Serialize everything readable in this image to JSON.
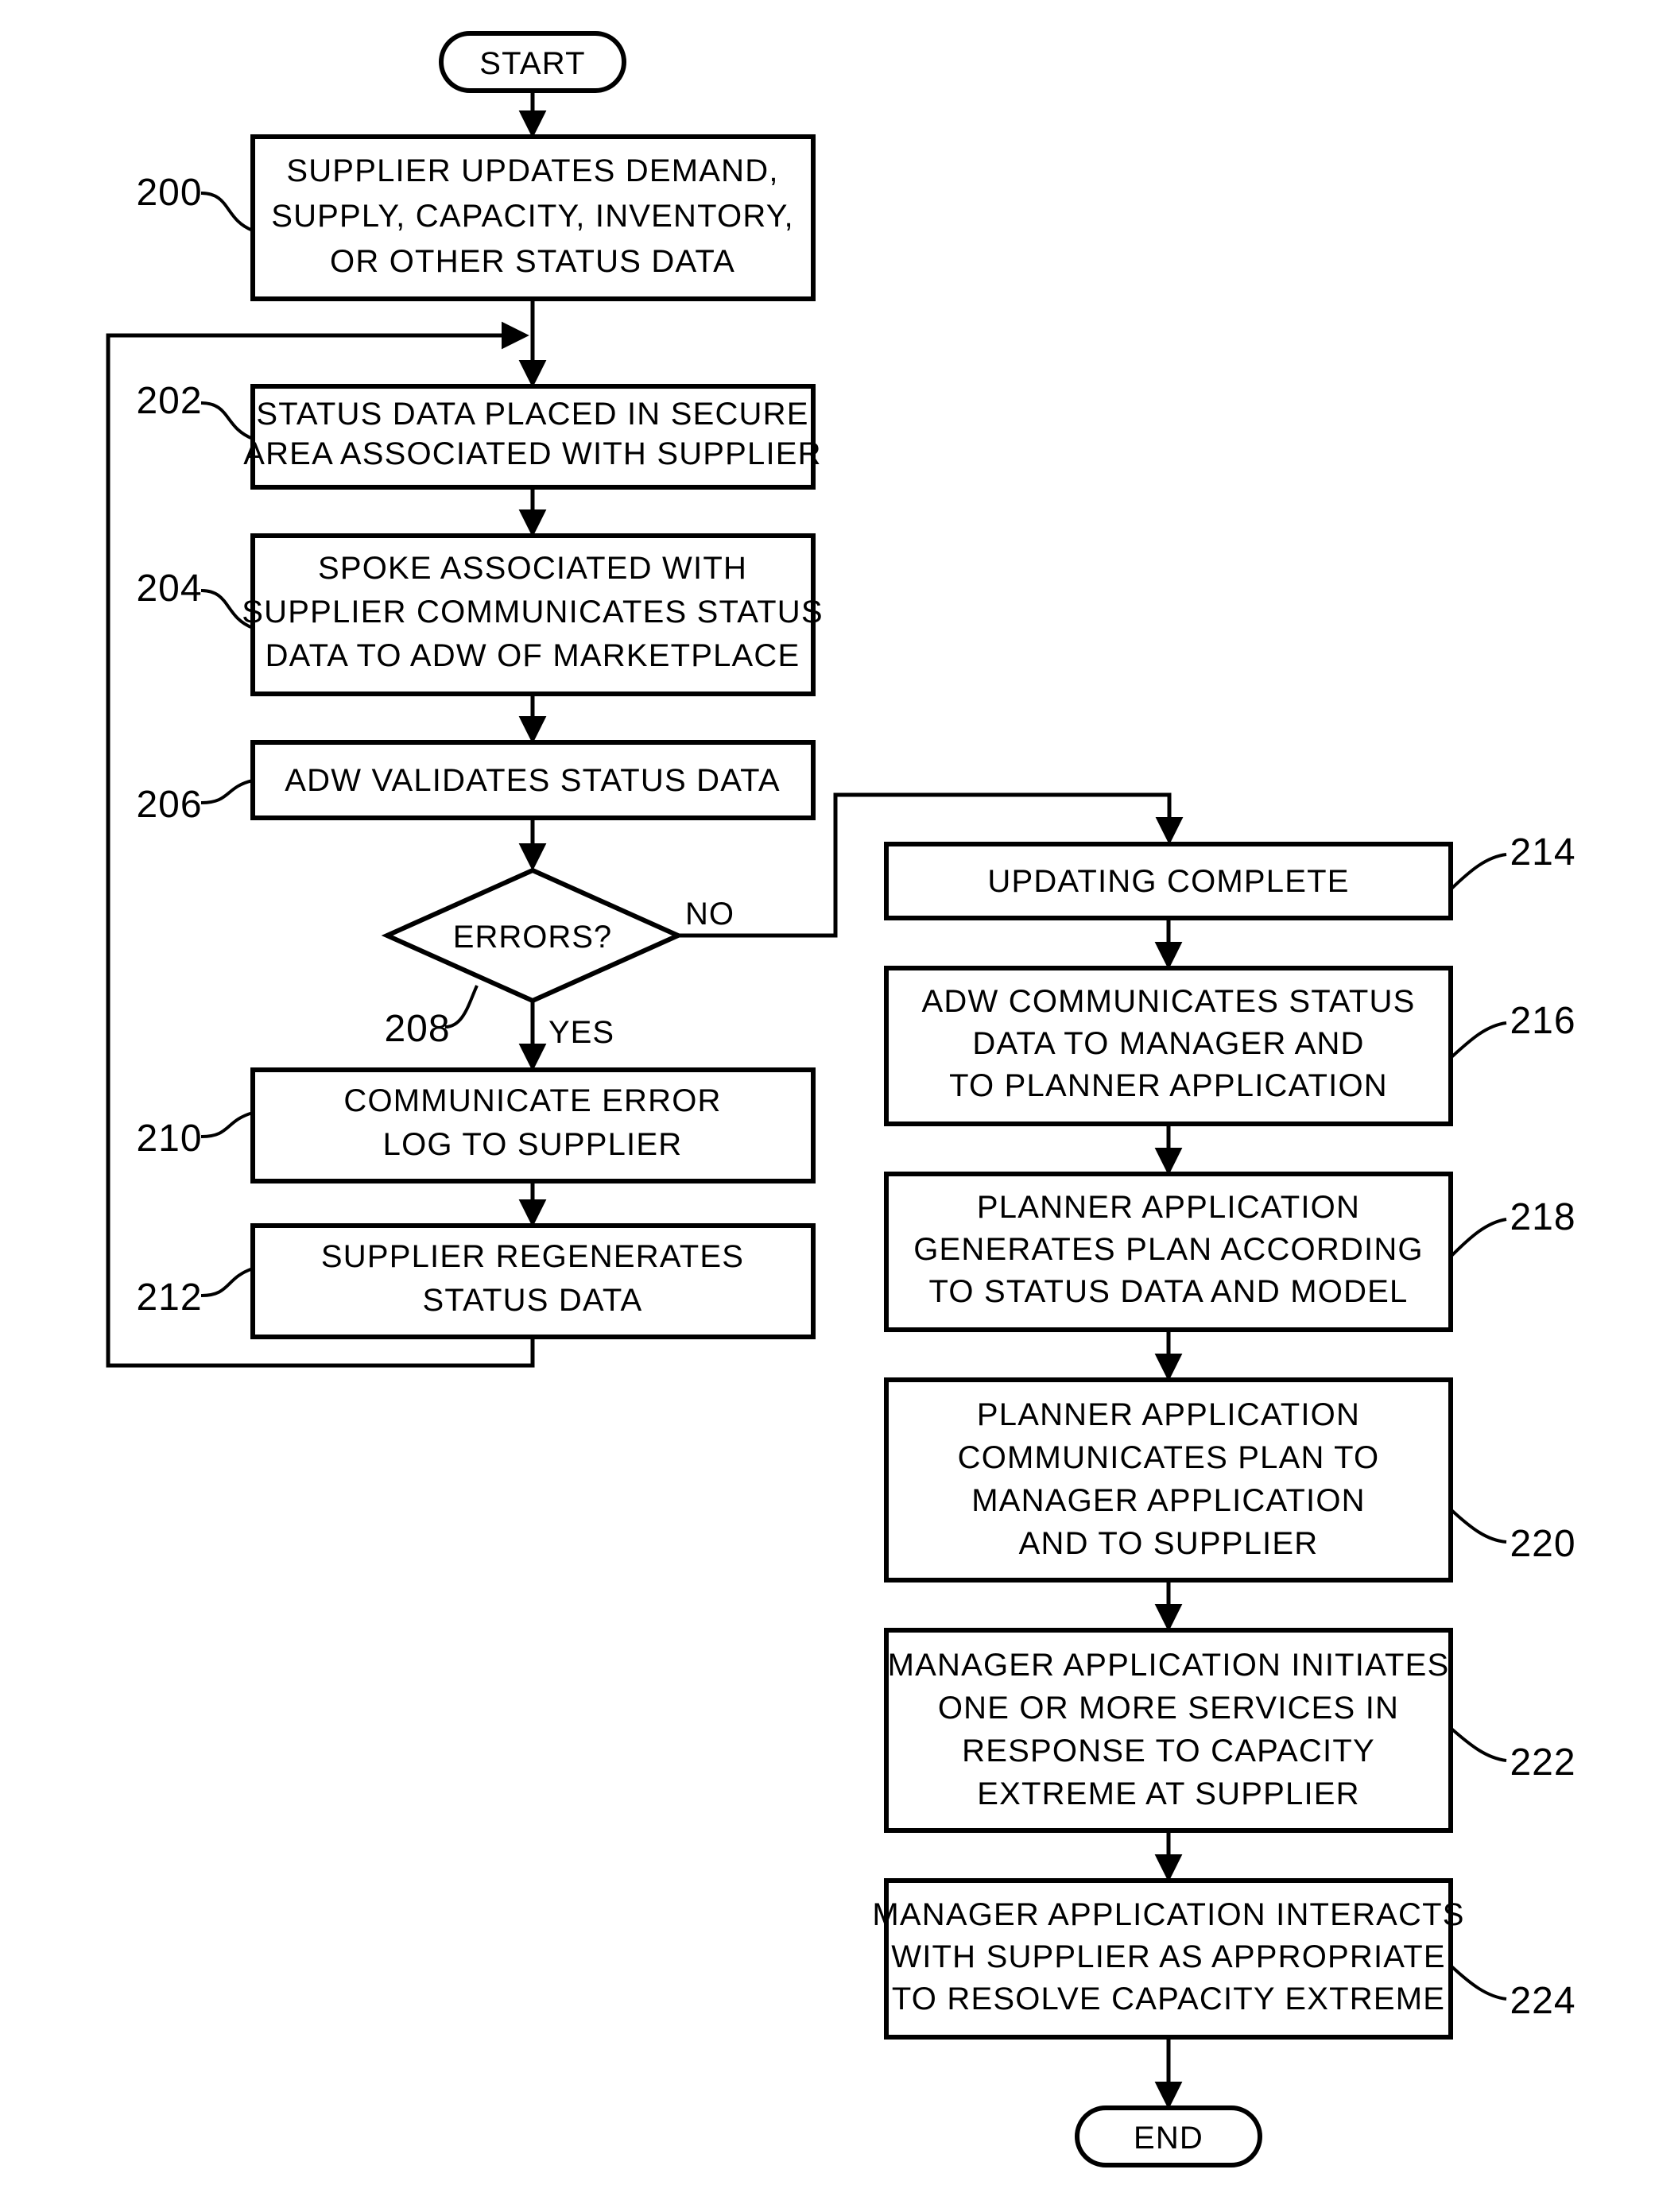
{
  "diagram": {
    "type": "flowchart",
    "title": "",
    "terminators": {
      "start": "START",
      "end": "END"
    },
    "decision": {
      "label": "ERRORS?",
      "ref": "208",
      "branch_yes": "YES",
      "branch_no": "NO"
    },
    "nodes": [
      {
        "ref": "200",
        "lines": [
          "SUPPLIER UPDATES DEMAND,",
          "SUPPLY, CAPACITY, INVENTORY,",
          "OR OTHER STATUS DATA"
        ]
      },
      {
        "ref": "202",
        "lines": [
          "STATUS DATA PLACED IN SECURE",
          "AREA ASSOCIATED WITH SUPPLIER"
        ]
      },
      {
        "ref": "204",
        "lines": [
          "SPOKE ASSOCIATED WITH",
          "SUPPLIER COMMUNICATES STATUS",
          "DATA TO ADW OF MARKETPLACE"
        ]
      },
      {
        "ref": "206",
        "lines": [
          "ADW VALIDATES STATUS DATA"
        ]
      },
      {
        "ref": "210",
        "lines": [
          "COMMUNICATE ERROR",
          "LOG TO SUPPLIER"
        ]
      },
      {
        "ref": "212",
        "lines": [
          "SUPPLIER REGENERATES",
          "STATUS DATA"
        ]
      },
      {
        "ref": "214",
        "lines": [
          "UPDATING COMPLETE"
        ]
      },
      {
        "ref": "216",
        "lines": [
          "ADW COMMUNICATES STATUS",
          "DATA TO MANAGER AND",
          "TO PLANNER APPLICATION"
        ]
      },
      {
        "ref": "218",
        "lines": [
          "PLANNER APPLICATION",
          "GENERATES PLAN ACCORDING",
          "TO STATUS DATA AND MODEL"
        ]
      },
      {
        "ref": "220",
        "lines": [
          "PLANNER APPLICATION",
          "COMMUNICATES PLAN TO",
          "MANAGER APPLICATION",
          "AND TO SUPPLIER"
        ]
      },
      {
        "ref": "222",
        "lines": [
          "MANAGER APPLICATION INITIATES",
          "ONE OR MORE SERVICES IN",
          "RESPONSE TO CAPACITY",
          "EXTREME AT SUPPLIER"
        ]
      },
      {
        "ref": "224",
        "lines": [
          "MANAGER APPLICATION INTERACTS",
          "WITH SUPPLIER AS APPROPRIATE",
          "TO RESOLVE CAPACITY EXTREME"
        ]
      }
    ],
    "colors": {
      "stroke": "#000000",
      "fill": "#ffffff",
      "text": "#000000"
    }
  }
}
